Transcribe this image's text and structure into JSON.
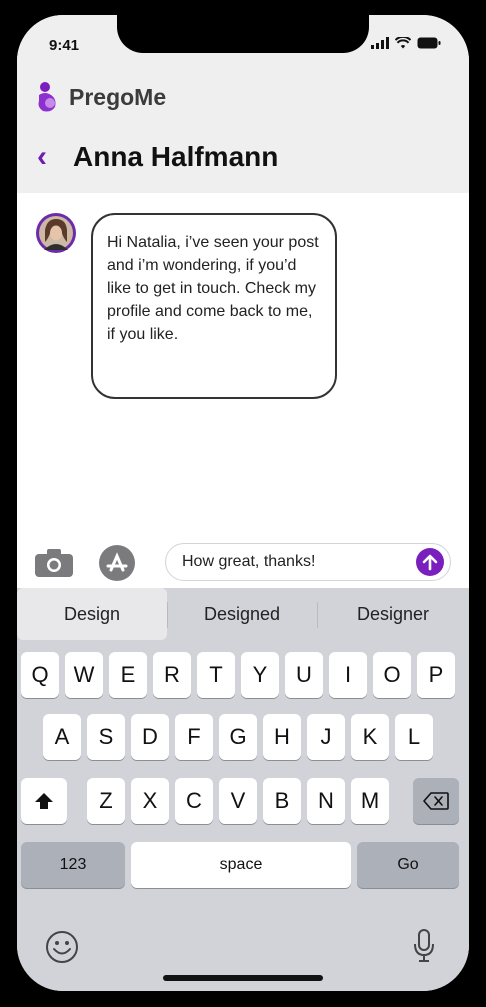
{
  "status": {
    "time": "9:41"
  },
  "app": {
    "name": "PregoMe"
  },
  "chat": {
    "back_icon": "chevron-left",
    "contact_name": "Anna Halfmann",
    "message": "Hi Natalia, i’ve seen your post and i’m wondering, if you’d like to get in touch. Check my profile and come back to me, if you like."
  },
  "composer": {
    "value": "How great, thanks!",
    "camera_icon": "camera-icon",
    "apps_icon": "app-store-icon",
    "send_icon": "arrow-up-icon"
  },
  "keyboard": {
    "suggestions": [
      "Design",
      "Designed",
      "Designer"
    ],
    "row1": [
      "Q",
      "W",
      "E",
      "R",
      "T",
      "Y",
      "U",
      "I",
      "O",
      "P"
    ],
    "row2": [
      "A",
      "S",
      "D",
      "F",
      "G",
      "H",
      "J",
      "K",
      "L"
    ],
    "row3": [
      "Z",
      "X",
      "C",
      "V",
      "B",
      "N",
      "M"
    ],
    "numbers_label": "123",
    "space_label": "space",
    "go_label": "Go"
  },
  "colors": {
    "accent": "#7a1fbd",
    "header_bg": "#efeff0",
    "keyboard_bg": "#d1d3d9"
  }
}
